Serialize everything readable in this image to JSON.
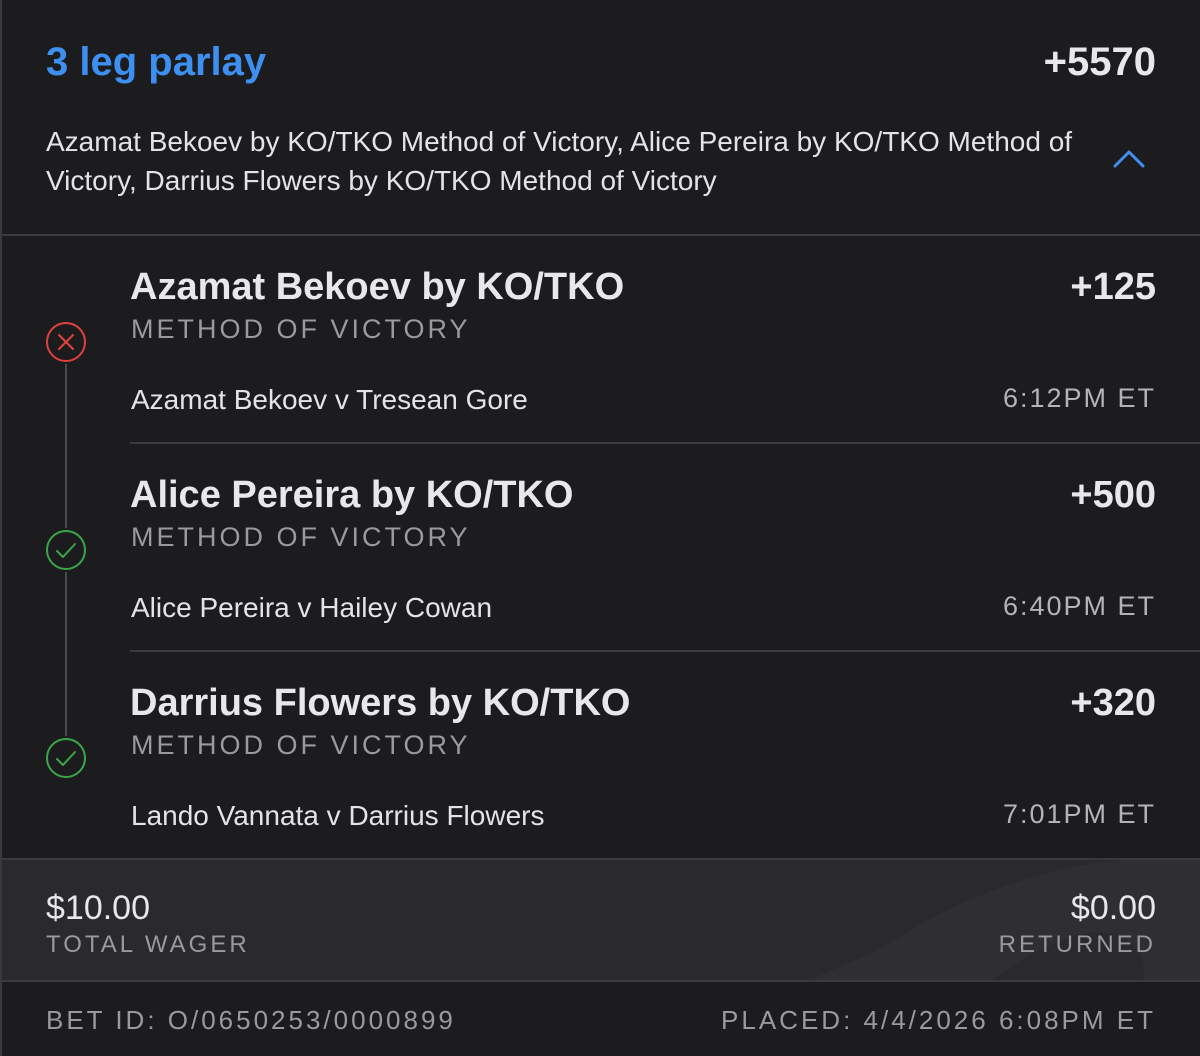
{
  "header": {
    "title": "3 leg parlay",
    "odds": "+5570",
    "description": "Azamat Bekoev by KO/TKO Method of Victory, Alice Pereira by KO/TKO Method of Victory, Darrius Flowers by KO/TKO Method of Victory",
    "toggle_icon": "chevron-up-icon"
  },
  "legs": [
    {
      "selection": "Azamat Bekoev by KO/TKO",
      "odds": "+125",
      "market": "METHOD OF VICTORY",
      "matchup": "Azamat Bekoev v Tresean Gore",
      "time": "6:12PM ET",
      "status": "lost",
      "status_icon": "x-circle-icon",
      "status_color": "#e0403f"
    },
    {
      "selection": "Alice Pereira by KO/TKO",
      "odds": "+500",
      "market": "METHOD OF VICTORY",
      "matchup": "Alice Pereira v Hailey Cowan",
      "time": "6:40PM ET",
      "status": "won",
      "status_icon": "check-circle-icon",
      "status_color": "#3aa64a"
    },
    {
      "selection": "Darrius Flowers by KO/TKO",
      "odds": "+320",
      "market": "METHOD OF VICTORY",
      "matchup": "Lando Vannata v Darrius Flowers",
      "time": "7:01PM ET",
      "status": "won",
      "status_icon": "check-circle-icon",
      "status_color": "#3aa64a"
    }
  ],
  "wager": {
    "amount": "$10.00",
    "amount_label": "TOTAL WAGER",
    "returned": "$0.00",
    "returned_label": "RETURNED"
  },
  "footer": {
    "bet_id": "BET ID: O/0650253/0000899",
    "placed": "PLACED: 4/4/2026 6:08PM ET"
  },
  "colors": {
    "accent": "#3d8ff0",
    "background": "#1c1c1e",
    "wager_background": "#2a2a2d"
  }
}
